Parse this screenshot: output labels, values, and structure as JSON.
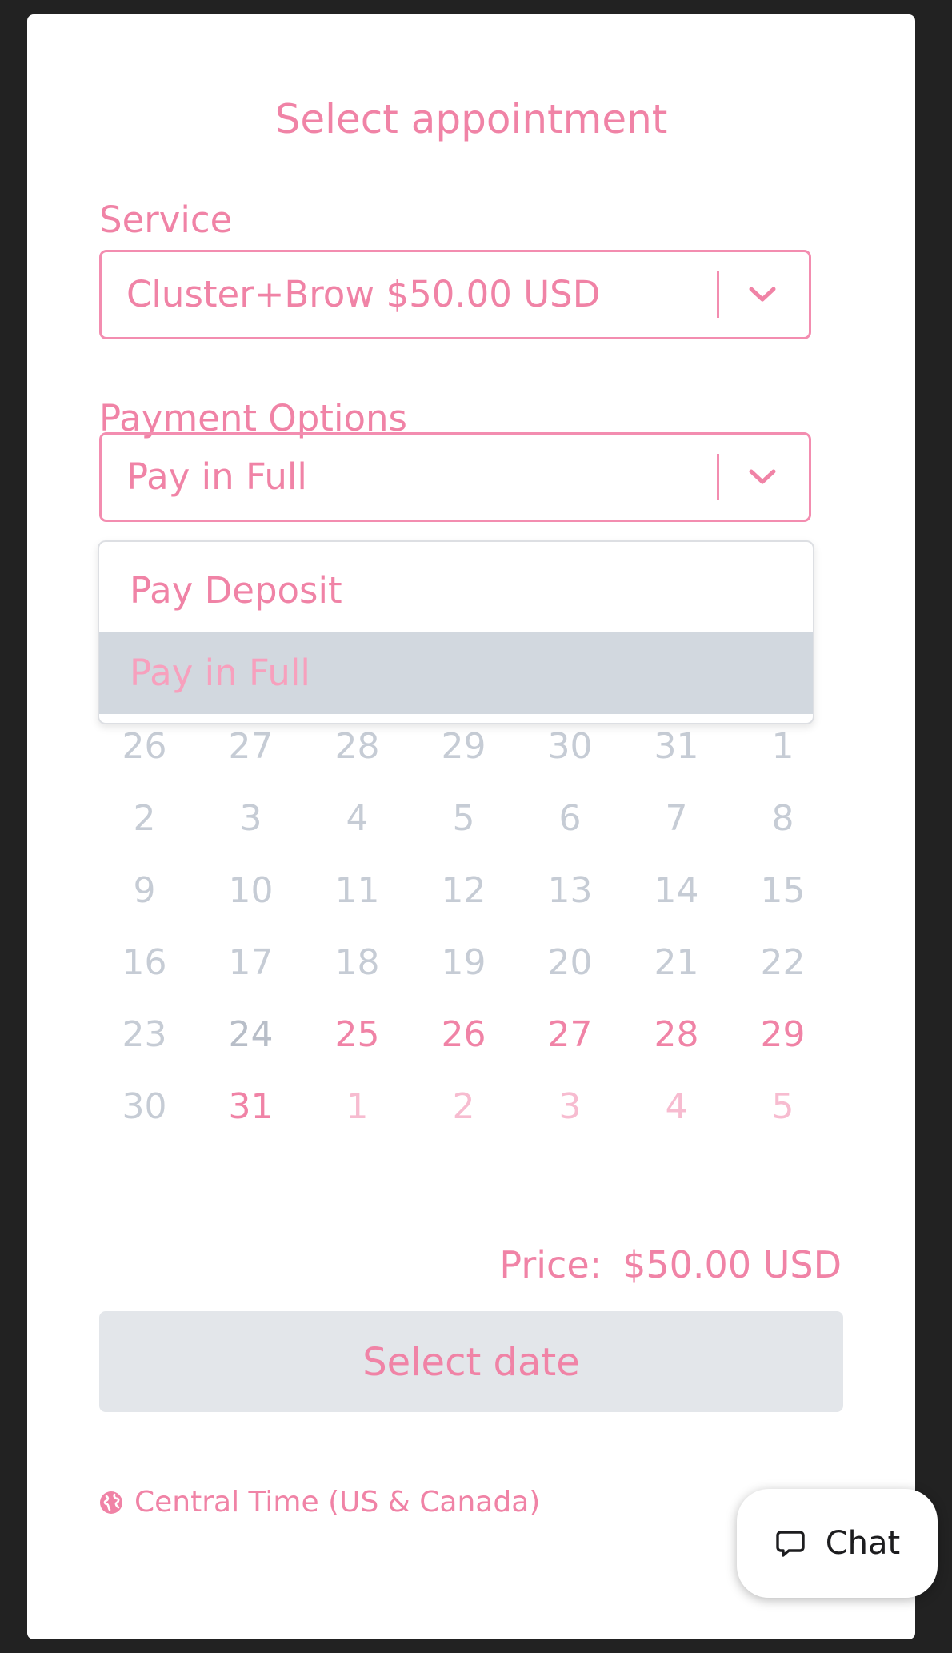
{
  "page": {
    "title": "Select appointment"
  },
  "service": {
    "label": "Service",
    "value": "Cluster+Brow $50.00 USD"
  },
  "payment": {
    "label": "Payment Options",
    "value": "Pay in Full",
    "options": [
      {
        "label": "Pay Deposit",
        "selected": false
      },
      {
        "label": "Pay in Full",
        "selected": true
      }
    ]
  },
  "calendar": {
    "weeks": [
      [
        {
          "d": "26",
          "s": "past"
        },
        {
          "d": "27",
          "s": "past"
        },
        {
          "d": "28",
          "s": "past"
        },
        {
          "d": "29",
          "s": "past"
        },
        {
          "d": "30",
          "s": "past"
        },
        {
          "d": "31",
          "s": "past"
        },
        {
          "d": "1",
          "s": "past"
        }
      ],
      [
        {
          "d": "2",
          "s": "past"
        },
        {
          "d": "3",
          "s": "past"
        },
        {
          "d": "4",
          "s": "past"
        },
        {
          "d": "5",
          "s": "past"
        },
        {
          "d": "6",
          "s": "past"
        },
        {
          "d": "7",
          "s": "past"
        },
        {
          "d": "8",
          "s": "past"
        }
      ],
      [
        {
          "d": "9",
          "s": "past"
        },
        {
          "d": "10",
          "s": "past"
        },
        {
          "d": "11",
          "s": "past"
        },
        {
          "d": "12",
          "s": "past"
        },
        {
          "d": "13",
          "s": "past"
        },
        {
          "d": "14",
          "s": "past"
        },
        {
          "d": "15",
          "s": "past"
        }
      ],
      [
        {
          "d": "16",
          "s": "past"
        },
        {
          "d": "17",
          "s": "past"
        },
        {
          "d": "18",
          "s": "past"
        },
        {
          "d": "19",
          "s": "past"
        },
        {
          "d": "20",
          "s": "past"
        },
        {
          "d": "21",
          "s": "past"
        },
        {
          "d": "22",
          "s": "past"
        }
      ],
      [
        {
          "d": "23",
          "s": "past"
        },
        {
          "d": "24",
          "s": "today"
        },
        {
          "d": "25",
          "s": "avail"
        },
        {
          "d": "26",
          "s": "avail"
        },
        {
          "d": "27",
          "s": "avail"
        },
        {
          "d": "28",
          "s": "avail"
        },
        {
          "d": "29",
          "s": "avail"
        }
      ],
      [
        {
          "d": "30",
          "s": "past"
        },
        {
          "d": "31",
          "s": "avail"
        },
        {
          "d": "1",
          "s": "next"
        },
        {
          "d": "2",
          "s": "next"
        },
        {
          "d": "3",
          "s": "next"
        },
        {
          "d": "4",
          "s": "next"
        },
        {
          "d": "5",
          "s": "next"
        }
      ]
    ]
  },
  "price": {
    "label": "Price:",
    "amount": "$50.00 USD"
  },
  "action": {
    "label": "Select date"
  },
  "timezone": {
    "label": "Central Time (US & Canada)",
    "icon": "globe-icon"
  },
  "chat": {
    "label": "Chat",
    "icon": "chat-bubble-icon"
  },
  "colors": {
    "accent": "#f083a6",
    "muted": "#c6ccd5",
    "selected_bg": "#d2d8df"
  }
}
